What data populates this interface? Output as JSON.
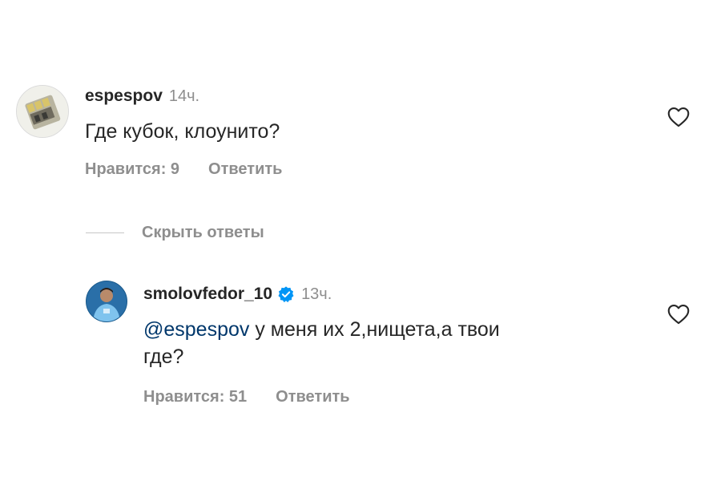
{
  "comment1": {
    "username": "espespov",
    "time": "14ч.",
    "text": "Где кубок, клоунито?",
    "likes_label": "Нравится: 9",
    "reply_label": "Ответить"
  },
  "hide_replies_label": "Скрыть ответы",
  "comment2": {
    "username": "smolovfedor_10",
    "time": "13ч.",
    "mention": "@espespov",
    "text_line1": " у меня их 2,нищета,а твои",
    "text_line2": "где?",
    "likes_label": "Нравится: 51",
    "reply_label": "Ответить"
  },
  "colors": {
    "text": "#262626",
    "secondary": "#8e8e8e",
    "mention": "#00376b",
    "verified": "#0095f6"
  },
  "icons": {
    "like": "heart-outline-icon",
    "verified": "verified-badge-icon"
  }
}
